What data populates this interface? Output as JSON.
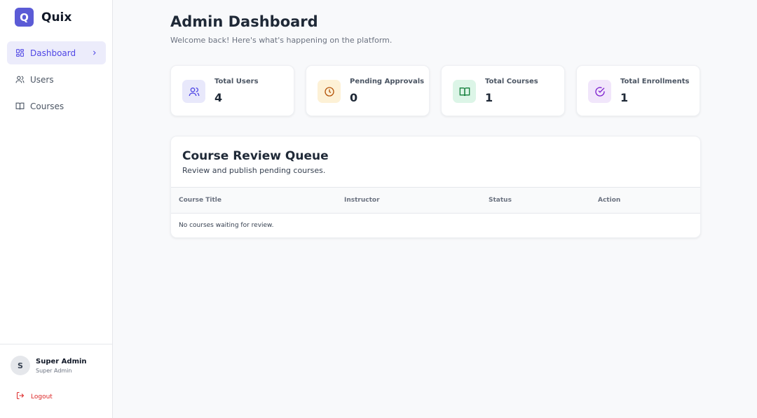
{
  "brand": {
    "logo_letter": "Q",
    "name": "Quix",
    "color": "#5b5bd6"
  },
  "nav": {
    "items": [
      {
        "label": "Dashboard",
        "icon": "grid-icon",
        "active": true
      },
      {
        "label": "Users",
        "icon": "users-icon",
        "active": false
      },
      {
        "label": "Courses",
        "icon": "book-icon",
        "active": false
      }
    ]
  },
  "user": {
    "initial": "S",
    "name": "Super Admin",
    "role": "Super Admin"
  },
  "logout": {
    "label": "Logout"
  },
  "page": {
    "title": "Admin Dashboard",
    "subtitle": "Welcome back! Here's what's happening on the platform."
  },
  "stats": [
    {
      "label": "Total Users",
      "value": "4",
      "icon": "users-icon",
      "bg": "#e8e8fb",
      "color": "#4f46e5"
    },
    {
      "label": "Pending Approvals",
      "value": "0",
      "icon": "clock-icon",
      "bg": "#fdf1d6",
      "color": "#b45309"
    },
    {
      "label": "Total Courses",
      "value": "1",
      "icon": "book-open-icon",
      "bg": "#dcf5e7",
      "color": "#15803d"
    },
    {
      "label": "Total Enrollments",
      "value": "1",
      "icon": "check-circle-icon",
      "bg": "#f1e6fb",
      "color": "#7e22ce"
    }
  ],
  "queue": {
    "title": "Course Review Queue",
    "subtitle": "Review and publish pending courses.",
    "columns": [
      "Course Title",
      "Instructor",
      "Status",
      "Action"
    ],
    "empty_message": "No courses waiting for review."
  }
}
